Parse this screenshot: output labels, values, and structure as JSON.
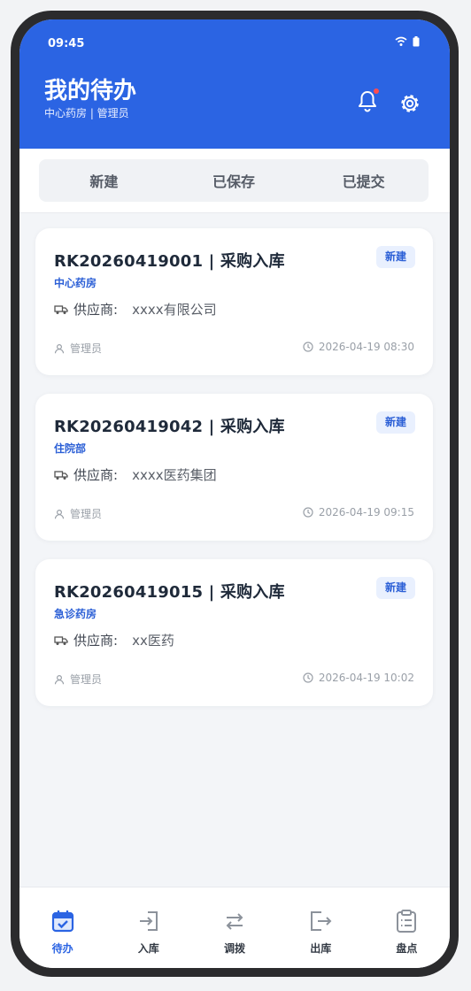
{
  "status": {
    "time": "09:45"
  },
  "header": {
    "title": "我的待办",
    "subtitle": "中心药房 | 管理员"
  },
  "tabs": [
    {
      "label": "新建"
    },
    {
      "label": "已保存"
    },
    {
      "label": "已提交"
    }
  ],
  "cards": [
    {
      "title": "RK20260419001 | 采购入库",
      "badge": "新建",
      "dept": "中心药房",
      "supplier_label": "供应商:",
      "supplier": "xxxx有限公司",
      "user": "管理员",
      "time": "2026-04-19 08:30"
    },
    {
      "title": "RK20260419042 | 采购入库",
      "badge": "新建",
      "dept": "住院部",
      "supplier_label": "供应商:",
      "supplier": "xxxx医药集团",
      "user": "管理员",
      "time": "2026-04-19 09:15"
    },
    {
      "title": "RK20260419015 | 采购入库",
      "badge": "新建",
      "dept": "急诊药房",
      "supplier_label": "供应商:",
      "supplier": "xx医药",
      "user": "管理员",
      "time": "2026-04-19 10:02"
    }
  ],
  "nav": [
    {
      "label": "待办",
      "icon": "calendar-check-icon"
    },
    {
      "label": "入库",
      "icon": "inbound-icon"
    },
    {
      "label": "调拨",
      "icon": "transfer-icon"
    },
    {
      "label": "出库",
      "icon": "outbound-icon"
    },
    {
      "label": "盘点",
      "icon": "clipboard-list-icon"
    }
  ],
  "colors": {
    "primary": "#2b64e3",
    "badge_bg": "#e9f0fe",
    "notification_dot": "#ff4d4f"
  }
}
